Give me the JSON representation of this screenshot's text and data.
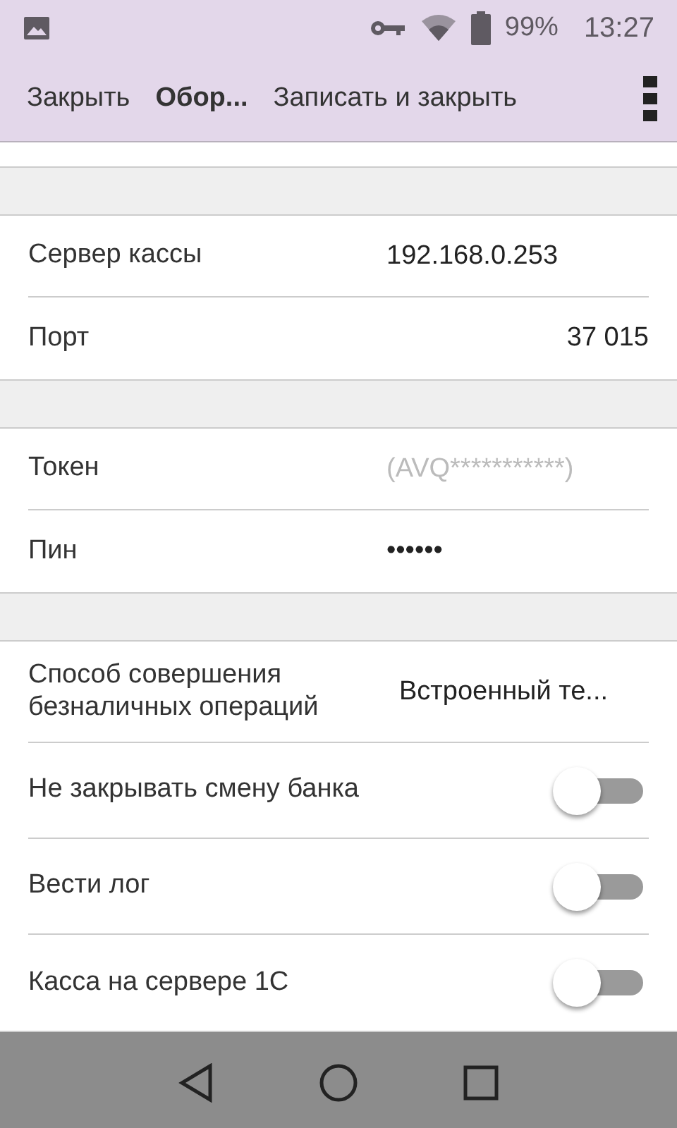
{
  "status_bar": {
    "battery": "99%",
    "time": "13:27"
  },
  "toolbar": {
    "actions": [
      {
        "label": "Закрыть",
        "kind": "plain"
      },
      {
        "label": "Обор...",
        "kind": "title"
      },
      {
        "label": "Записать и закрыть",
        "kind": "plain"
      }
    ]
  },
  "sections": [
    {
      "rows": [
        {
          "kind": "value",
          "label": "Сервер кассы",
          "value": "192.168.0.253"
        },
        {
          "kind": "number",
          "label": "Порт",
          "value": "37 015"
        }
      ]
    },
    {
      "rows": [
        {
          "kind": "hint",
          "label": "Токен",
          "placeholder": "(AVQ***********)"
        },
        {
          "kind": "value",
          "label": "Пин",
          "value": "••••••"
        }
      ]
    },
    {
      "rows": [
        {
          "kind": "choice",
          "label": "Способ совершения безналичных операций",
          "value": "Встроенный те..."
        },
        {
          "kind": "toggle",
          "label": "Не закрывать смену банка",
          "on": false
        },
        {
          "kind": "toggle",
          "label": "Вести лог",
          "on": false
        },
        {
          "kind": "toggle",
          "label": "Касса на сервере 1С",
          "on": false
        }
      ]
    }
  ]
}
